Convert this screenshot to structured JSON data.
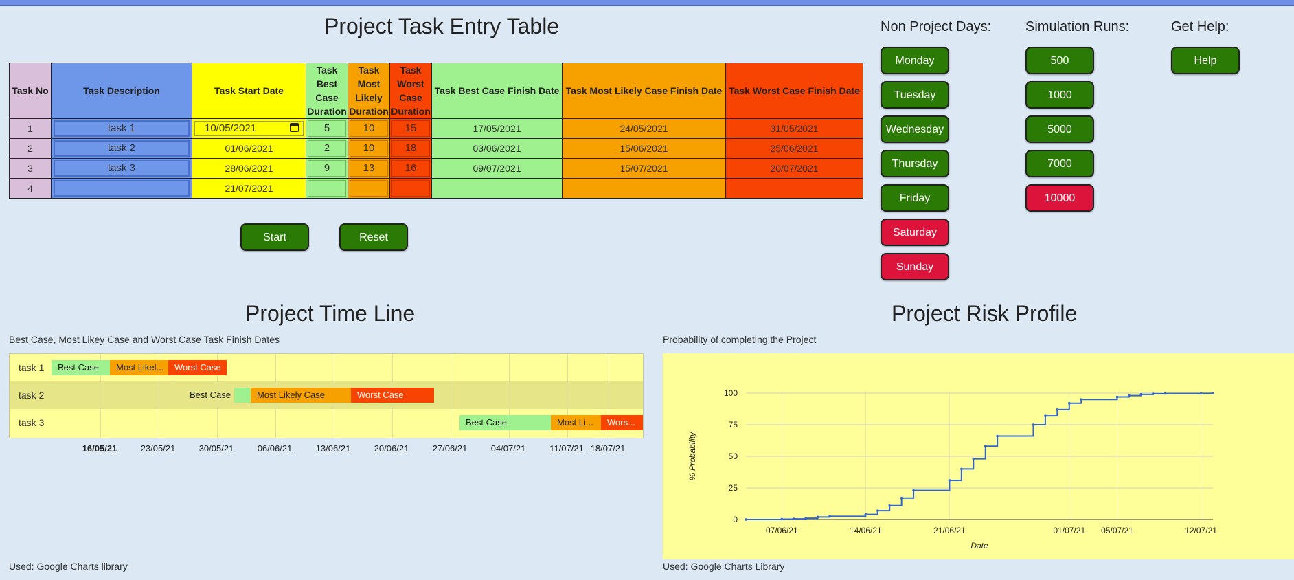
{
  "entry": {
    "title": "Project Task Entry Table",
    "headers": [
      "Task No",
      "Task Description",
      "Task Start Date",
      "Task Best Case Duration",
      "Task Most Likely Duration",
      "Task Worst Case Duration",
      "Task Best Case Finish Date",
      "Task Most Likely Case Finish Date",
      "Task Worst Case Finish Date"
    ],
    "header_lines": {
      "best": [
        "Task",
        "Best",
        "Case",
        "Duration"
      ],
      "ml": [
        "Task",
        "Most",
        "Likely",
        "Duration"
      ],
      "worst": [
        "Task",
        "Worst",
        "Case",
        "Duration"
      ]
    },
    "rows": [
      {
        "no": "1",
        "desc": "task 1",
        "start": "10/05/2021",
        "best": "5",
        "ml": "10",
        "worst": "15",
        "best_finish": "17/05/2021",
        "ml_finish": "24/05/2021",
        "worst_finish": "31/05/2021"
      },
      {
        "no": "2",
        "desc": "task 2",
        "start": "01/06/2021",
        "best": "2",
        "ml": "10",
        "worst": "18",
        "best_finish": "03/06/2021",
        "ml_finish": "15/06/2021",
        "worst_finish": "25/06/2021"
      },
      {
        "no": "3",
        "desc": "task 3",
        "start": "28/06/2021",
        "best": "9",
        "ml": "13",
        "worst": "16",
        "best_finish": "09/07/2021",
        "ml_finish": "15/07/2021",
        "worst_finish": "20/07/2021"
      },
      {
        "no": "4",
        "desc": "",
        "start": "21/07/2021",
        "best": "",
        "ml": "",
        "worst": "",
        "best_finish": "",
        "ml_finish": "",
        "worst_finish": ""
      }
    ],
    "start_button": "Start",
    "reset_button": "Reset"
  },
  "non_project_days": {
    "title": "Non Project Days:",
    "days": [
      {
        "label": "Monday",
        "color": "#2b7a05"
      },
      {
        "label": "Tuesday",
        "color": "#2b7a05"
      },
      {
        "label": "Wednesday",
        "color": "#2b7a05"
      },
      {
        "label": "Thursday",
        "color": "#2b7a05"
      },
      {
        "label": "Friday",
        "color": "#2b7a05"
      },
      {
        "label": "Saturday",
        "color": "#dc143c"
      },
      {
        "label": "Sunday",
        "color": "#dc143c"
      }
    ]
  },
  "simulation": {
    "title": "Simulation Runs:",
    "runs": [
      {
        "label": "500",
        "color": "#2b7a05"
      },
      {
        "label": "1000",
        "color": "#2b7a05"
      },
      {
        "label": "5000",
        "color": "#2b7a05"
      },
      {
        "label": "7000",
        "color": "#2b7a05"
      },
      {
        "label": "10000",
        "color": "#dc143c"
      }
    ]
  },
  "help": {
    "title": "Get Help:",
    "button": "Help"
  },
  "colors": {
    "best": "#9ff08e",
    "most_likely": "#f7a100",
    "worst": "#f84402",
    "green_button": "#2b7a05",
    "red_button": "#dc143c",
    "chart_bg": "#ffff99"
  },
  "timeline": {
    "title": "Project Time Line",
    "caption": "Best Case, Most Likey Case and Worst Case Task Finish Dates",
    "footer": "Used: Google Charts library",
    "tasks": [
      {
        "name": "task 1",
        "best": "Best Case",
        "ml": "Most Likel...",
        "worst": "Worst Case"
      },
      {
        "name": "task 2",
        "best": "Best Case",
        "ml": "Most Likely Case",
        "worst": "Worst Case"
      },
      {
        "name": "task 3",
        "best": "Best Case",
        "ml": "Most Li...",
        "worst": "Wors..."
      }
    ],
    "ticks": [
      "16/05/21",
      "23/05/21",
      "30/05/21",
      "06/06/21",
      "13/06/21",
      "20/06/21",
      "27/06/21",
      "04/07/21",
      "11/07/21",
      "18/07/21"
    ]
  },
  "risk": {
    "title": "Project Risk Profile",
    "caption": "Probability of completing the Project",
    "footer": "Used: Google Charts Library"
  },
  "chart_data": {
    "type": "line",
    "title": "",
    "xlabel": "Date",
    "ylabel": "% Probability",
    "ylim": [
      0,
      100
    ],
    "yticks": [
      0,
      25,
      50,
      75,
      100
    ],
    "xticks": [
      "07/06/21",
      "14/06/21",
      "21/06/21",
      "01/07/21",
      "05/07/21",
      "12/07/21"
    ],
    "grid": true,
    "step": true,
    "series": [
      {
        "color": "#3366cc",
        "x": [
          "2021-06-04",
          "2021-06-07",
          "2021-06-08",
          "2021-06-09",
          "2021-06-10",
          "2021-06-11",
          "2021-06-14",
          "2021-06-15",
          "2021-06-16",
          "2021-06-17",
          "2021-06-18",
          "2021-06-21",
          "2021-06-22",
          "2021-06-23",
          "2021-06-24",
          "2021-06-25",
          "2021-06-28",
          "2021-06-29",
          "2021-06-30",
          "2021-07-01",
          "2021-07-02",
          "2021-07-05",
          "2021-07-06",
          "2021-07-07",
          "2021-07-08",
          "2021-07-09",
          "2021-07-12",
          "2021-07-13"
        ],
        "y": [
          0,
          0.3,
          0.5,
          1,
          2,
          2.5,
          4,
          7,
          11,
          17,
          23,
          31,
          40,
          48,
          58,
          66,
          75,
          82,
          87,
          92,
          95,
          97,
          98,
          99,
          99.5,
          99.7,
          99.8,
          100
        ]
      }
    ]
  }
}
